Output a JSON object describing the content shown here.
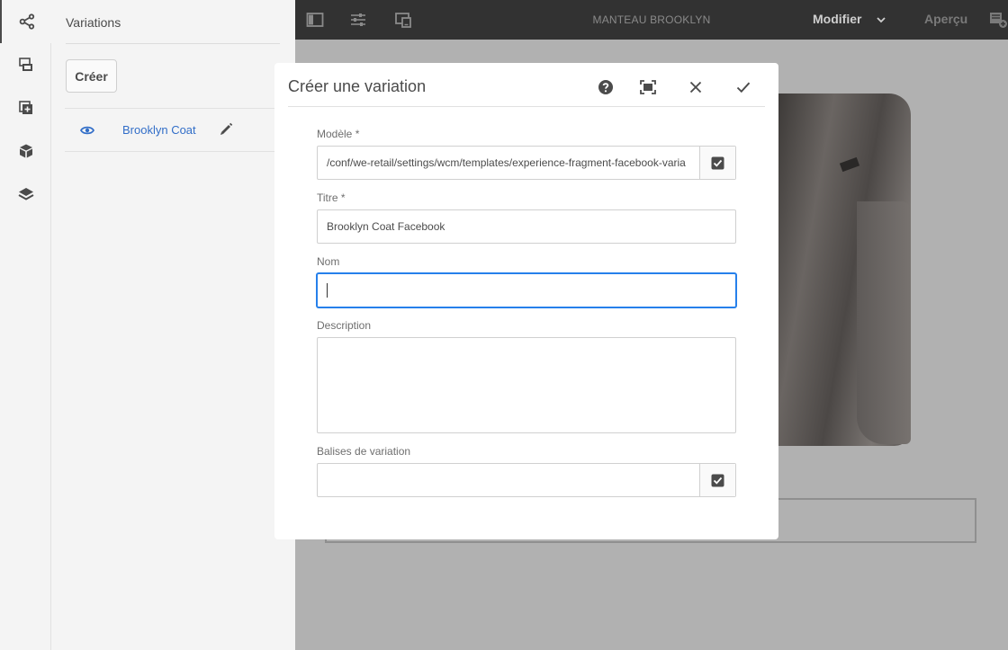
{
  "rail": {
    "items": [
      {
        "name": "variations-icon",
        "active": true
      },
      {
        "name": "assets-icon",
        "active": false
      },
      {
        "name": "components-icon",
        "active": false
      },
      {
        "name": "content-tree-icon",
        "active": false
      },
      {
        "name": "layers-icon",
        "active": false
      }
    ]
  },
  "panel": {
    "title": "Variations",
    "create_label": "Créer",
    "variation": {
      "label": "Brooklyn Coat"
    }
  },
  "toolbar": {
    "page_title": "MANTEAU BROOKLYN",
    "mode_label": "Modifier",
    "preview_label": "Aperçu"
  },
  "dialog": {
    "title": "Créer une variation",
    "fields": {
      "template": {
        "label": "Modèle *",
        "value": "/conf/we-retail/settings/wcm/templates/experience-fragment-facebook-varia"
      },
      "title": {
        "label": "Titre *",
        "value": "Brooklyn Coat Facebook"
      },
      "name": {
        "label": "Nom",
        "value": ""
      },
      "description": {
        "label": "Description",
        "value": ""
      },
      "tags": {
        "label": "Balises de variation",
        "value": ""
      }
    }
  },
  "colors": {
    "toolbar_bg": "#323232",
    "accent": "#2680eb",
    "link": "#326ec8",
    "overlay": "#b1b1b1"
  }
}
